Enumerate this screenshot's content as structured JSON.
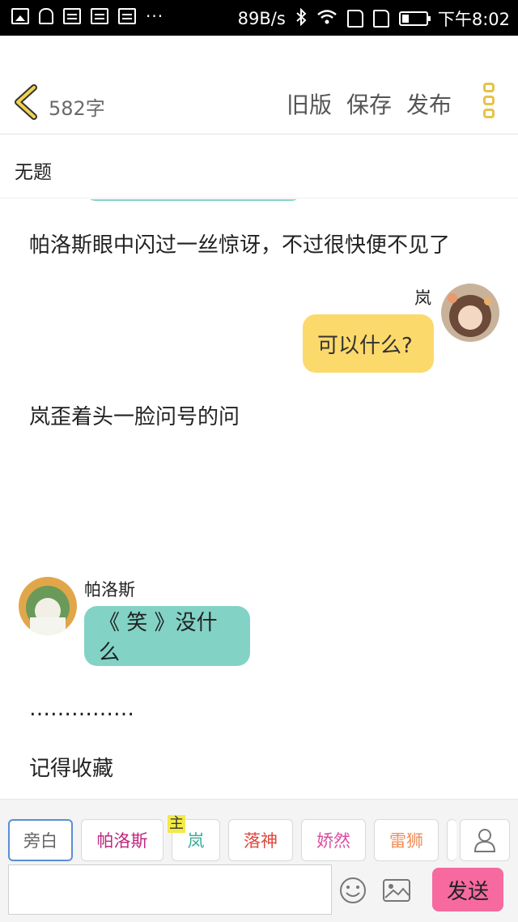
{
  "status_bar": {
    "left_icons": [
      "image-icon",
      "bell-icon",
      "keyboard-icon",
      "keyboard-icon",
      "keyboard-icon"
    ],
    "more": "···",
    "net_speed": "89B/s",
    "right_icons": [
      "bluetooth-icon",
      "wifi-icon",
      "sim-card-icon",
      "sim-card-icon",
      "battery-icon"
    ],
    "time": "下午8:02"
  },
  "header": {
    "word_count": "582字",
    "old_version": "旧版",
    "save": "保存",
    "publish": "发布"
  },
  "title": "无题",
  "content": {
    "narr1": "帕洛斯眼中闪过一丝惊讶，不过很快便不见了",
    "msg1": {
      "speaker": "岚",
      "text": "可以什么?"
    },
    "narr2": "岚歪着头一脸问号的问",
    "msg2": {
      "speaker": "帕洛斯",
      "text": "《 笑 》没什么"
    },
    "narr3": "……………",
    "narr4": "记得收藏"
  },
  "characters": [
    {
      "label": "旁白",
      "color": "#666666"
    },
    {
      "label": "帕洛斯",
      "color": "#c0267e"
    },
    {
      "label": "岚",
      "color": "#3aada0",
      "badge": "主"
    },
    {
      "label": "落神",
      "color": "#e0463c"
    },
    {
      "label": "娇然",
      "color": "#d94fa0"
    },
    {
      "label": "雷狮",
      "color": "#ef8f5a"
    }
  ],
  "composer": {
    "input_value": "",
    "send": "发送"
  },
  "colors": {
    "accent_yellow": "#e6c24a",
    "bubble_yellow": "#fcd96b",
    "bubble_teal": "#82d3c6",
    "send_pink": "#f76aa0"
  }
}
